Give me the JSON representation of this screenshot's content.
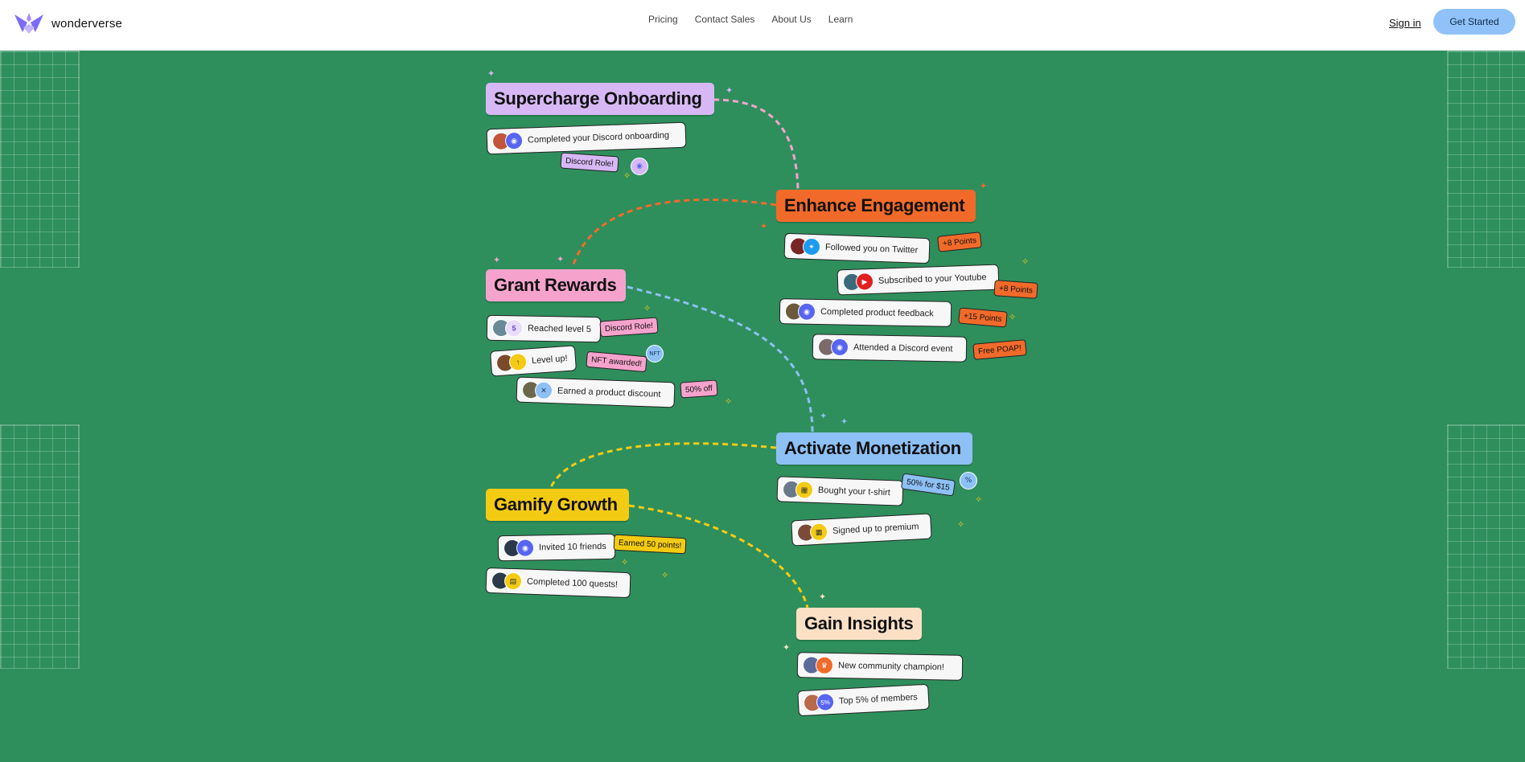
{
  "nav": {
    "brand": "wonderverse",
    "links": [
      "Pricing",
      "Contact Sales",
      "About Us",
      "Learn"
    ],
    "sign_in": "Sign in",
    "get_started": "Get Started"
  },
  "colors": {
    "background": "#2e8f5c",
    "onboarding": "#d7b8f5",
    "engagement": "#f26a2a",
    "rewards": "#f5a3cd",
    "monetization": "#8dc0f5",
    "growth": "#f4cb13",
    "insights": "#fbe0c6"
  },
  "sections": {
    "onboarding": {
      "title": "Supercharge Onboarding",
      "items": [
        "Completed your Discord onboarding"
      ],
      "tags": [
        "Discord Role!"
      ]
    },
    "engagement": {
      "title": "Enhance Engagement",
      "items": [
        "Followed you on Twitter",
        "Subscribed to your Youtube",
        "Completed product feedback",
        "Attended a Discord event"
      ],
      "tags": [
        "+8 Points",
        "+8 Points",
        "+15 Points",
        "Free POAP!"
      ]
    },
    "rewards": {
      "title": "Grant Rewards",
      "items": [
        "Reached level 5",
        "Level up!",
        "Earned a product discount"
      ],
      "tags": [
        "Discord Role!",
        "NFT awarded!",
        "50% off"
      ],
      "level_badge": "5"
    },
    "monetization": {
      "title": "Activate Monetization",
      "items": [
        "Bought your t-shirt",
        "Signed up to premium"
      ],
      "tags": [
        "50% for $15"
      ]
    },
    "growth": {
      "title": "Gamify Growth",
      "items": [
        "Invited 10 friends",
        "Completed 100 quests!"
      ],
      "tags": [
        "Earned 50 points!"
      ]
    },
    "insights": {
      "title": "Gain Insights",
      "items": [
        "New community champion!",
        "Top 5% of members"
      ],
      "badge": "5%"
    }
  },
  "icons": [
    "logo-icon",
    "discord-icon",
    "twitter-icon",
    "youtube-icon",
    "level-badge-icon",
    "arrow-up-icon",
    "discount-icon",
    "shop-icon",
    "quest-icon",
    "crown-icon",
    "percent-badge-icon",
    "sparkle-icon"
  ]
}
